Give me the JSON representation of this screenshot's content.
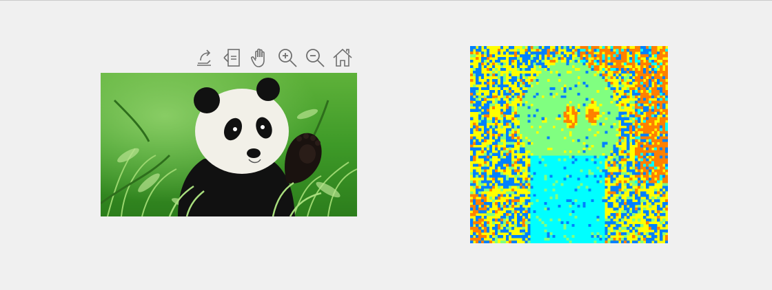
{
  "window": {
    "topline_color": "#c9c9c9",
    "background": "#f0f0f0"
  },
  "toolbar": {
    "buttons": [
      {
        "name": "export-icon",
        "tooltip": ""
      },
      {
        "name": "brush-icon",
        "tooltip": ""
      },
      {
        "name": "pan-icon",
        "tooltip": ""
      },
      {
        "name": "zoom-in-icon",
        "tooltip": ""
      },
      {
        "name": "zoom-out-icon",
        "tooltip": ""
      },
      {
        "name": "home-icon",
        "tooltip": ""
      }
    ],
    "icon_color": "#6e6e6e"
  },
  "left_axes": {
    "content": "panda-photo",
    "colors": {
      "grass_dark": "#2f7a1f",
      "grass_mid": "#4fa82f",
      "grass_light": "#8fd16a",
      "fur_white": "#f2f0e8",
      "fur_black": "#111111"
    }
  },
  "right_axes": {
    "content": "segmented-panda",
    "palette": [
      "#0080ff",
      "#ffff00",
      "#80ff80",
      "#00ffff",
      "#ff8000"
    ]
  }
}
